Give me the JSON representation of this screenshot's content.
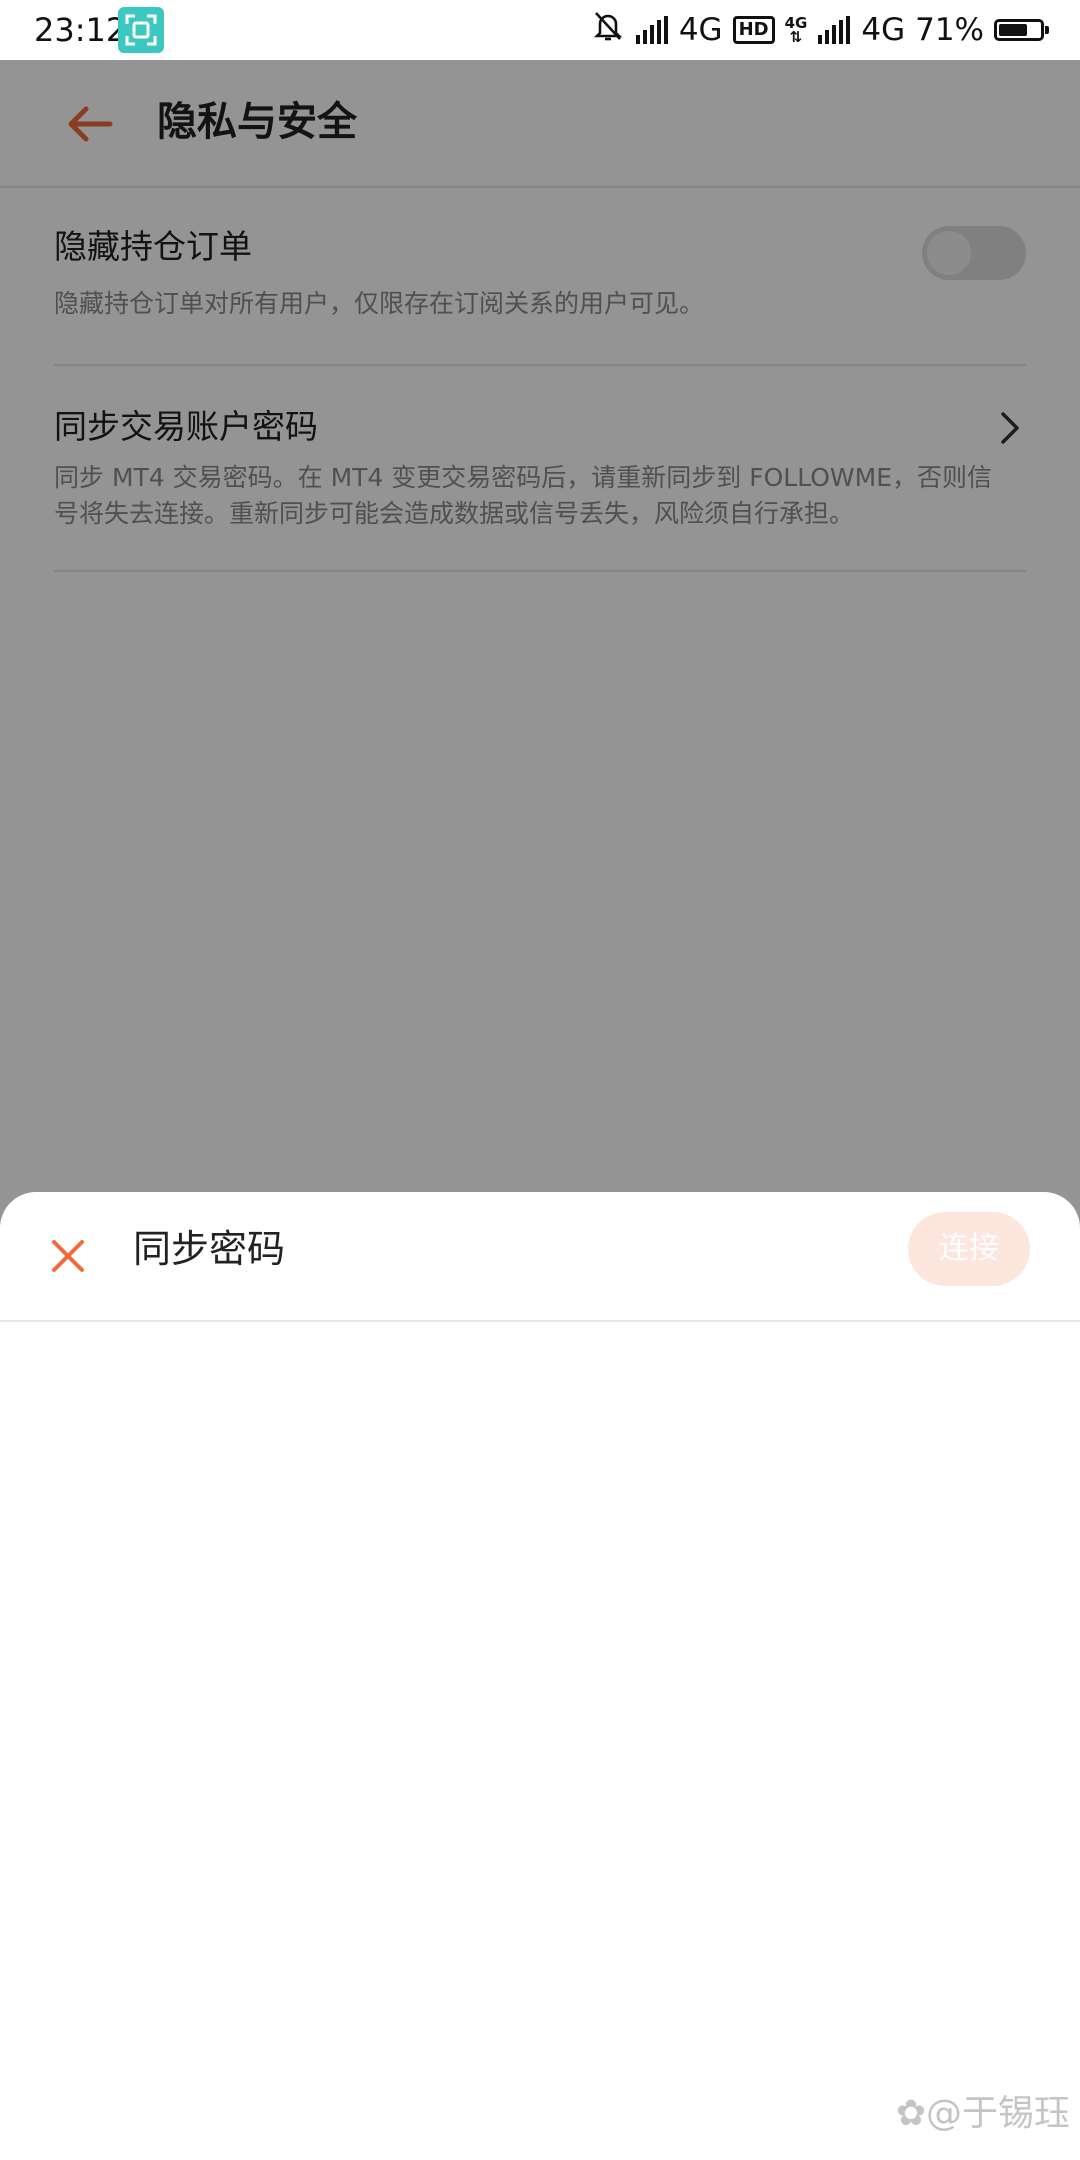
{
  "status_bar": {
    "time": "23:12",
    "network_1": "4G",
    "hd_label": "HD",
    "mini_network": "4G",
    "network_2": "4G",
    "battery_text": "71%",
    "battery_level": 0.71
  },
  "page": {
    "title": "隐私与安全",
    "items": [
      {
        "title": "隐藏持仓订单",
        "description": "隐藏持仓订单对所有用户，仅限存在订阅关系的用户可见。",
        "toggle_on": false
      },
      {
        "title": "同步交易账户密码",
        "description": "同步 MT4 交易密码。在 MT4 变更交易密码后，请重新同步到 FOLLOWME，否则信号将失去连接。重新同步可能会造成数据或信号丢失，风险须自行承担。"
      }
    ]
  },
  "sheet": {
    "title": "同步密码",
    "connect_label": "连接"
  },
  "watermark": "@于锡珏",
  "colors": {
    "accent": "#f06a3c",
    "connect_disabled_bg": "#fde6dd",
    "screenshot_badge": "#3cc7c0"
  }
}
